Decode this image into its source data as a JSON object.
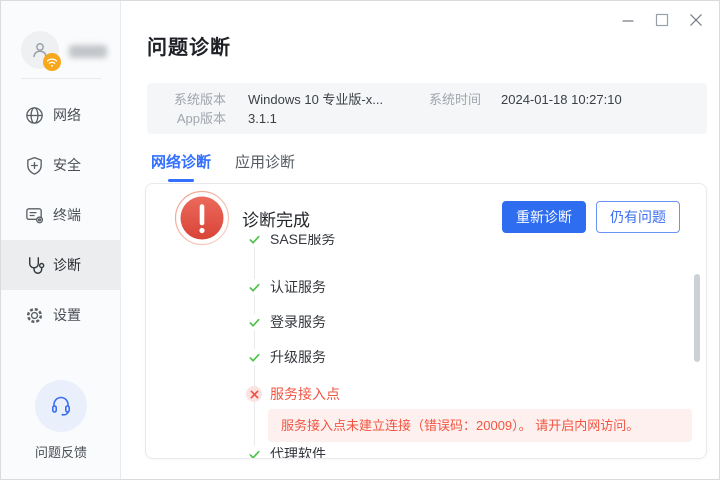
{
  "window": {
    "controls": {
      "minimize": "minimize",
      "maximize": "maximize",
      "close": "close"
    }
  },
  "sidebar": {
    "user": {
      "name_masked": true
    },
    "items": [
      {
        "label": "网络",
        "icon": "globe-icon",
        "selected": false
      },
      {
        "label": "安全",
        "icon": "shield-plus-icon",
        "selected": false
      },
      {
        "label": "终端",
        "icon": "terminal-gear-icon",
        "selected": false
      },
      {
        "label": "诊断",
        "icon": "stethoscope-icon",
        "selected": true
      },
      {
        "label": "设置",
        "icon": "gear-icon",
        "selected": false
      }
    ],
    "feedback_label": "问题反馈"
  },
  "page": {
    "title": "问题诊断"
  },
  "info_bar": {
    "system_version_label": "系统版本",
    "system_version_value": "Windows 10 专业版-x...",
    "app_version_label": "App版本",
    "app_version_value": "3.1.1",
    "system_time_label": "系统时间",
    "system_time_value": "2024-01-18 10:27:10"
  },
  "tabs": [
    {
      "label": "网络诊断",
      "active": true
    },
    {
      "label": "应用诊断",
      "active": false
    }
  ],
  "panel": {
    "status_title": "诊断完成",
    "rediagnose_label": "重新诊断",
    "still_issue_label": "仍有问题",
    "checks": [
      {
        "label": "SASE服务",
        "status": "success"
      },
      {
        "label": "认证服务",
        "status": "success"
      },
      {
        "label": "登录服务",
        "status": "success"
      },
      {
        "label": "升级服务",
        "status": "success"
      },
      {
        "label": "服务接入点",
        "status": "error",
        "message": "服务接入点未建立连接（错误码：20009）。 请开启内网访问。"
      },
      {
        "label": "代理软件",
        "status": "success"
      }
    ]
  },
  "colors": {
    "accent": "#2e6cf0",
    "tab_active": "#3370ff",
    "success": "#4fc24a",
    "error": "#f25643",
    "error_bg": "#fdf0ee",
    "alert_red": "#e05043",
    "badge_orange": "#f7a81d",
    "sidebar_bg": "#fafbfc",
    "info_bar_bg": "#f5f6f8"
  }
}
